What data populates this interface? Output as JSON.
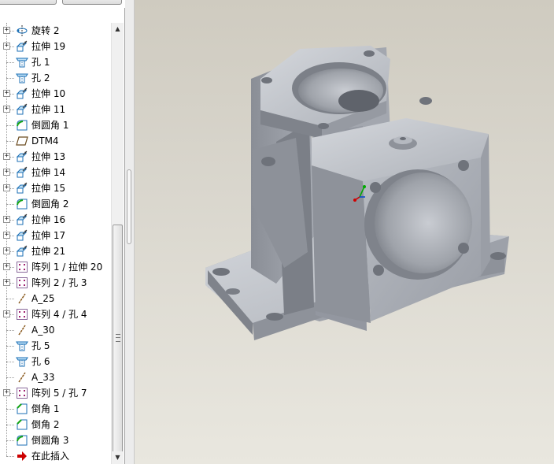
{
  "model_tree": {
    "items": [
      {
        "label": "旋转 2",
        "icon": "revolve-icon",
        "expandable": true
      },
      {
        "label": "拉伸 19",
        "icon": "extrude-icon",
        "expandable": true
      },
      {
        "label": "孔 1",
        "icon": "hole-icon",
        "expandable": false
      },
      {
        "label": "孔 2",
        "icon": "hole-icon",
        "expandable": false
      },
      {
        "label": "拉伸 10",
        "icon": "extrude-icon",
        "expandable": true
      },
      {
        "label": "拉伸 11",
        "icon": "extrude-icon",
        "expandable": true
      },
      {
        "label": "倒圆角 1",
        "icon": "round-icon",
        "expandable": false
      },
      {
        "label": "DTM4",
        "icon": "datum-plane-icon",
        "expandable": false
      },
      {
        "label": "拉伸 13",
        "icon": "extrude-icon",
        "expandable": true
      },
      {
        "label": "拉伸 14",
        "icon": "extrude-icon",
        "expandable": true
      },
      {
        "label": "拉伸 15",
        "icon": "extrude-icon",
        "expandable": true
      },
      {
        "label": "倒圆角 2",
        "icon": "round-icon",
        "expandable": false
      },
      {
        "label": "拉伸 16",
        "icon": "extrude-icon",
        "expandable": true
      },
      {
        "label": "拉伸 17",
        "icon": "extrude-icon",
        "expandable": true
      },
      {
        "label": "拉伸 21",
        "icon": "extrude-icon",
        "expandable": true
      },
      {
        "label": "阵列 1 / 拉伸 20",
        "icon": "pattern-icon",
        "expandable": true
      },
      {
        "label": "阵列 2 / 孔 3",
        "icon": "pattern-icon",
        "expandable": true
      },
      {
        "label": "A_25",
        "icon": "datum-axis-icon",
        "expandable": false
      },
      {
        "label": "阵列 4 / 孔 4",
        "icon": "pattern-icon",
        "expandable": true
      },
      {
        "label": "A_30",
        "icon": "datum-axis-icon",
        "expandable": false
      },
      {
        "label": "孔 5",
        "icon": "hole-icon",
        "expandable": false
      },
      {
        "label": "孔 6",
        "icon": "hole-icon",
        "expandable": false
      },
      {
        "label": "A_33",
        "icon": "datum-axis-icon",
        "expandable": false
      },
      {
        "label": "阵列 5 / 孔 7",
        "icon": "pattern-icon",
        "expandable": true
      },
      {
        "label": "倒角 1",
        "icon": "chamfer-icon",
        "expandable": false
      },
      {
        "label": "倒角 2",
        "icon": "chamfer-icon",
        "expandable": false
      },
      {
        "label": "倒圆角 3",
        "icon": "round-icon",
        "expandable": false
      },
      {
        "label": "在此插入",
        "icon": "insert-here-arrow-icon",
        "expandable": false
      }
    ]
  },
  "colors": {
    "tree_background": "#ffffff",
    "viewport_top": "#cfcbc0",
    "viewport_bottom": "#e9e7df",
    "model_face_light": "#c4c8ce",
    "model_face_mid": "#a6aab2",
    "model_face_dark": "#7c8088",
    "insert_arrow": "#cc0000"
  }
}
